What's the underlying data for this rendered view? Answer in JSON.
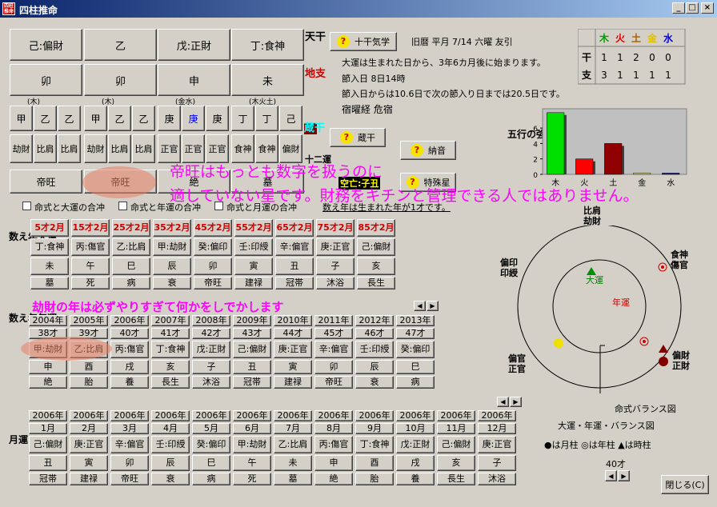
{
  "window": {
    "title": "四柱推命",
    "icon_text": "四柱推命",
    "minimize": "_",
    "maximize": "□",
    "close": "×"
  },
  "pillars": {
    "tenkan": [
      "己:偏財",
      "乙",
      "戊:正財",
      "丁:食神"
    ],
    "chishi": [
      "卯",
      "卯",
      "申",
      "未"
    ],
    "zokan_groups": [
      "(木)",
      "(木)",
      "(金水)",
      "(木火土)"
    ],
    "zokan": [
      [
        "甲",
        "乙",
        "乙"
      ],
      [
        "甲",
        "乙",
        "乙"
      ],
      [
        "庚",
        "庚",
        "庚"
      ],
      [
        "丁",
        "丁",
        "己"
      ]
    ],
    "zokan_stars": [
      [
        "劫財",
        "比肩",
        "比肩"
      ],
      [
        "劫財",
        "比肩",
        "比肩"
      ],
      [
        "正官",
        "正官",
        "正官"
      ],
      [
        "食神",
        "食神",
        "偏財"
      ]
    ],
    "unsei": [
      "帝旺",
      "帝旺",
      "絶",
      "墓"
    ]
  },
  "side_labels": {
    "tenkan": "天干",
    "chishi": "地支",
    "zokan": "蔵干",
    "unsei": "十二運"
  },
  "buttons": {
    "jikkan": "十干気学",
    "zokan": "蔵干",
    "nocchin": "納音",
    "tokushu": "特殊星",
    "close": "閉じる(C)"
  },
  "info": {
    "kyureki": "旧暦  平月 7/14  六曜 友引",
    "taiun_start": "大運は生まれた日から、3年6カ月後に始まります。",
    "setsuiri": "節入日  8日14時",
    "setsuiri_days": "節入日からは10.6日で次の節入り日までは20.5日です。",
    "shukuyo": "宿曜経 危宿",
    "kuubou": "空亡:子丑"
  },
  "gogyo_table": {
    "headers": [
      "木",
      "火",
      "土",
      "金",
      "水"
    ],
    "header_colors": [
      "#00a000",
      "#e00000",
      "#a06000",
      "#e0c000",
      "#0000e0"
    ],
    "row_labels": [
      "干",
      "支"
    ],
    "kan": [
      "1",
      "1",
      "2",
      "0",
      "0"
    ],
    "shi": [
      "3",
      "1",
      "1",
      "1",
      "1"
    ]
  },
  "chart_data": {
    "type": "bar",
    "title": "五行の強さ",
    "categories": [
      "木",
      "火",
      "土",
      "金",
      "水"
    ],
    "values": [
      8,
      2,
      4,
      0.1,
      0.1
    ],
    "colors": [
      "#00e000",
      "#ff0000",
      "#900000",
      "#ffff00",
      "#0000ff"
    ],
    "yticks": [
      "0",
      "2",
      "4",
      "6"
    ],
    "ylim": [
      0,
      8.5
    ]
  },
  "checkboxes": [
    "命式と大運の合冲",
    "命式と年運の合冲",
    "命式と月運の合冲"
  ],
  "kazoe_note": "数え年は生まれた年が1才です。",
  "overlay": {
    "line1": "帝旺はもっとも数字を扱うのに",
    "line2": "適していない星です。財務をキチンと管理できる人ではありません。",
    "line3": "劫財の年は必ずやりすぎて何かをしでかします"
  },
  "taiun": {
    "label": "数え年大運",
    "ages": [
      "5才2月",
      "15才2月",
      "25才2月",
      "35才2月",
      "45才2月",
      "55才2月",
      "65才2月",
      "75才2月",
      "85才2月"
    ],
    "kan": [
      "丁:食神",
      "丙:傷官",
      "乙:比肩",
      "甲:劫財",
      "癸:偏印",
      "壬:印綬",
      "辛:偏官",
      "庚:正官",
      "己:偏財"
    ],
    "shi": [
      "未",
      "午",
      "巳",
      "辰",
      "卯",
      "寅",
      "丑",
      "子",
      "亥"
    ],
    "unsei": [
      "墓",
      "死",
      "病",
      "衰",
      "帝旺",
      "建禄",
      "冠帯",
      "沐浴",
      "長生"
    ]
  },
  "nenun": {
    "label": "数え年年運",
    "years": [
      "2004年",
      "2005年",
      "2006年",
      "2007年",
      "2008年",
      "2009年",
      "2010年",
      "2011年",
      "2012年",
      "2013年"
    ],
    "ages": [
      "38才",
      "39才",
      "40才",
      "41才",
      "42才",
      "43才",
      "44才",
      "45才",
      "46才",
      "47才"
    ],
    "kan": [
      "甲:劫財",
      "乙:比肩",
      "丙:傷官",
      "丁:食神",
      "戊:正財",
      "己:偏財",
      "庚:正官",
      "辛:偏官",
      "壬:印綬",
      "癸:偏印"
    ],
    "shi": [
      "申",
      "酉",
      "戌",
      "亥",
      "子",
      "丑",
      "寅",
      "卯",
      "辰",
      "巳"
    ],
    "unsei": [
      "絶",
      "胎",
      "養",
      "長生",
      "沐浴",
      "冠帯",
      "建禄",
      "帝旺",
      "衰",
      "病"
    ]
  },
  "getsuun": {
    "label": "月運",
    "years": [
      "2006年",
      "2006年",
      "2006年",
      "2006年",
      "2006年",
      "2006年",
      "2006年",
      "2006年",
      "2006年",
      "2006年",
      "2006年",
      "2006年"
    ],
    "months": [
      "1月",
      "2月",
      "3月",
      "4月",
      "5月",
      "6月",
      "7月",
      "8月",
      "9月",
      "10月",
      "11月",
      "12月"
    ],
    "kan": [
      "己:偏財",
      "庚:正官",
      "辛:偏官",
      "壬:印綬",
      "癸:偏印",
      "甲:劫財",
      "乙:比肩",
      "丙:傷官",
      "丁:食神",
      "戊:正財",
      "己:偏財",
      "庚:正官"
    ],
    "shi": [
      "丑",
      "寅",
      "卯",
      "辰",
      "巳",
      "午",
      "未",
      "申",
      "酉",
      "戌",
      "亥",
      "子"
    ],
    "unsei": [
      "冠帯",
      "建禄",
      "帝旺",
      "衰",
      "病",
      "死",
      "墓",
      "絶",
      "胎",
      "養",
      "長生",
      "沐浴"
    ]
  },
  "scroll": {
    "left": "◀",
    "right": "▶"
  },
  "balance": {
    "top_label": "比肩\n劫財",
    "left_label": "偏印\n印綬",
    "right_top_label": "食神\n傷官",
    "left_bottom_label": "偏官\n正官",
    "right_bottom_label": "偏財\n正財",
    "taiun": "大運",
    "nenun": "年運",
    "meishiki_caption": "命式バランス図",
    "taiun_caption": "大運・年運・バランス図",
    "legend": "●は月柱  ◎は年柱  ▲は時柱",
    "age": "40才"
  }
}
